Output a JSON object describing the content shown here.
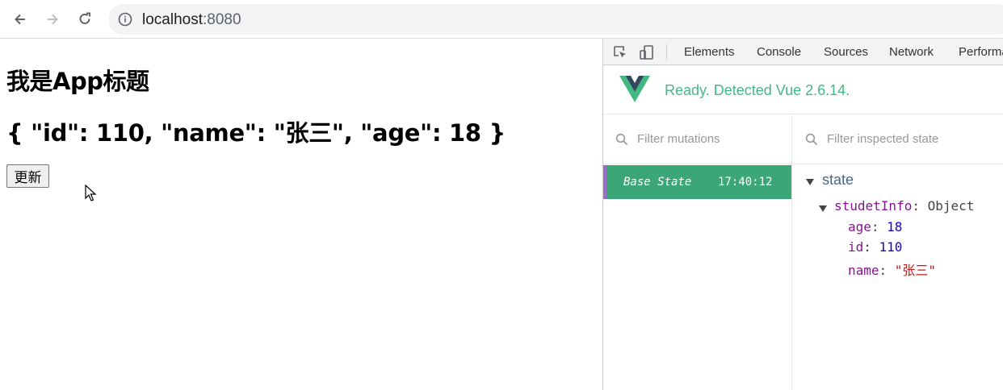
{
  "browser": {
    "url_host": "localhost",
    "url_port": ":8080"
  },
  "page": {
    "heading": "我是App标题",
    "json_display": "{ \"id\": 110, \"name\": \"张三\", \"age\": 18 }",
    "update_button": "更新"
  },
  "devtools": {
    "tabs": [
      "Elements",
      "Console",
      "Sources",
      "Network",
      "Performa"
    ],
    "vue_status": "Ready. Detected Vue 2.6.14.",
    "mutation_filter_placeholder": "Filter mutations",
    "state_filter_placeholder": "Filter inspected state",
    "base_state": {
      "label": "Base State",
      "time": "17:40:12"
    },
    "state_tree": {
      "root": "state",
      "object_key": "studetInfo",
      "object_type": "Object",
      "fields": [
        {
          "key": "age",
          "value": "18",
          "kind": "number"
        },
        {
          "key": "id",
          "value": "110",
          "kind": "number"
        },
        {
          "key": "name",
          "value": "\"张三\"",
          "kind": "string"
        }
      ]
    }
  },
  "colors": {
    "vue_green": "#42b983",
    "row_green": "#3ba776",
    "row_accent": "#9a6ec8"
  }
}
